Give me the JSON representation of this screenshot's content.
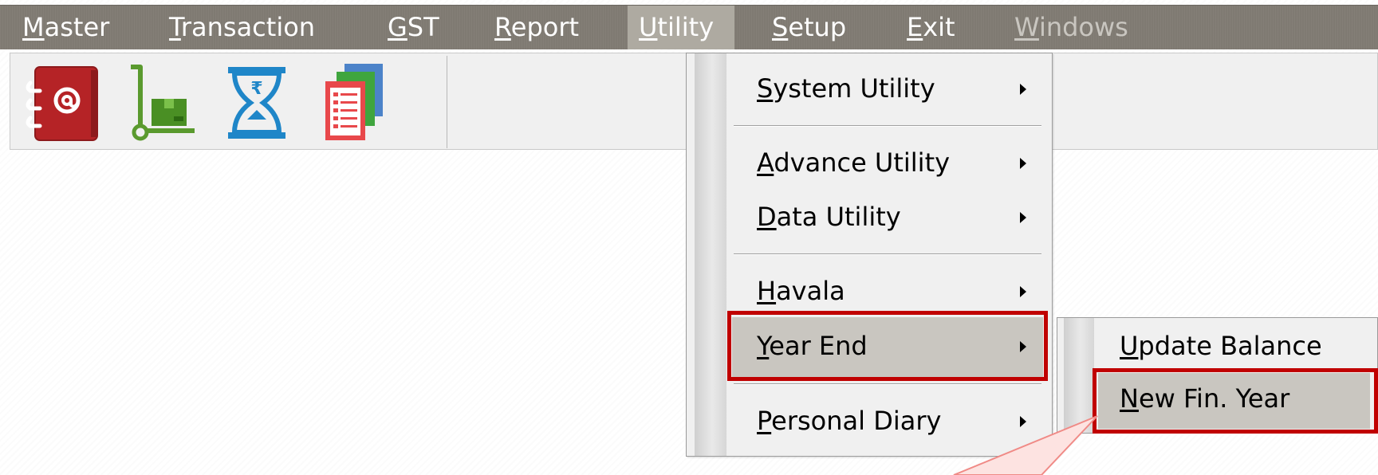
{
  "menubar": {
    "items": [
      {
        "first": "M",
        "rest": "aster"
      },
      {
        "first": "T",
        "rest": "ransaction"
      },
      {
        "first": "G",
        "rest": "ST"
      },
      {
        "first": "R",
        "rest": "eport"
      },
      {
        "first": "U",
        "rest": "tility"
      },
      {
        "first": "S",
        "rest": "etup"
      },
      {
        "first": "E",
        "rest": "xit"
      },
      {
        "first": "W",
        "rest": "indows"
      }
    ]
  },
  "toolbar": {
    "icons": [
      "address-book-icon",
      "hand-truck-icon",
      "hourglass-rupee-icon",
      "documents-icon"
    ]
  },
  "utility_menu": {
    "items": [
      {
        "first": "S",
        "rest": "ystem Utility"
      },
      {
        "first": "A",
        "rest": "dvance Utility"
      },
      {
        "first": "D",
        "rest": "ata Utility"
      },
      {
        "first": "H",
        "rest": "avala"
      },
      {
        "first": "Y",
        "rest": "ear End"
      },
      {
        "first": "P",
        "rest": "ersonal Diary"
      }
    ]
  },
  "year_end_submenu": {
    "items": [
      {
        "first": "U",
        "rest": "pdate Balance"
      },
      {
        "first": "N",
        "rest": "ew Fin. Year"
      }
    ]
  },
  "colors": {
    "menubar_bg": "#7f7a72",
    "highlight_box": "#c00000",
    "icon_red": "#c0282a",
    "icon_green": "#5a9a2e",
    "icon_blue": "#1f86c8"
  }
}
